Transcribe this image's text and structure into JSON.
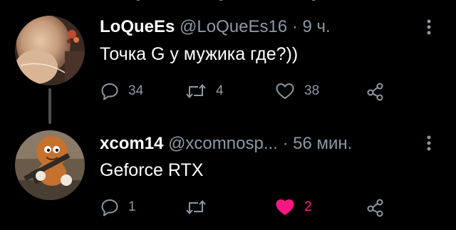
{
  "tweets": [
    {
      "name": "LoQueEs",
      "handle": "@LoQueEs16",
      "time": "9 ч.",
      "text": "Точка G  у мужика где?))",
      "replies": "34",
      "retweets": "4",
      "likes": "38",
      "liked": false
    },
    {
      "name": "xcom14",
      "handle": "@xcomnosp...",
      "time": "56 мин.",
      "text": "Geforce RTX",
      "replies": "1",
      "retweets": "",
      "likes": "2",
      "liked": true
    }
  ],
  "separator": "·",
  "colors": {
    "background": "#000000",
    "primary_text": "#ffffff",
    "secondary_text": "#8b98a5",
    "like_active": "#f91880",
    "thread_line": "#4a4f55"
  },
  "icons": {
    "reply": "reply-icon",
    "retweet": "retweet-icon",
    "like": "heart-icon",
    "share": "share-icon",
    "more": "more-options-icon"
  }
}
